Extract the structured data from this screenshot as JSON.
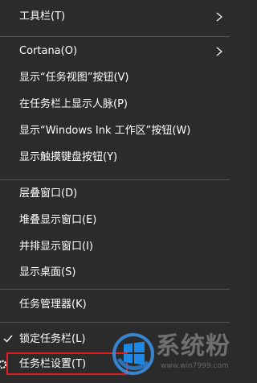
{
  "menu": {
    "items": [
      {
        "label": "工具栏(T)"
      },
      {
        "label": "Cortana(O)"
      },
      {
        "label": "显示“任务视图”按钮(V)"
      },
      {
        "label": "在任务栏上显示人脉(P)"
      },
      {
        "label": "显示“Windows Ink 工作区”按钮(W)"
      },
      {
        "label": "显示触摸键盘按钮(Y)"
      },
      {
        "label": "层叠窗口(D)"
      },
      {
        "label": "堆叠显示窗口(E)"
      },
      {
        "label": "并排显示窗口(I)"
      },
      {
        "label": "显示桌面(S)"
      },
      {
        "label": "任务管理器(K)"
      },
      {
        "label": "锁定任务栏(L)"
      },
      {
        "label": "任务栏设置(T)"
      }
    ]
  },
  "watermark": {
    "text": "系统粉",
    "sub": "www.win7999.com"
  },
  "colors": {
    "menu_bg": "#2b2b2b",
    "separator": "#555555",
    "text": "#ffffff",
    "highlight": "#e02020"
  },
  "icons": {
    "submenu": "chevron-right-icon",
    "checked": "checkmark-icon",
    "settings": "gear-icon"
  }
}
